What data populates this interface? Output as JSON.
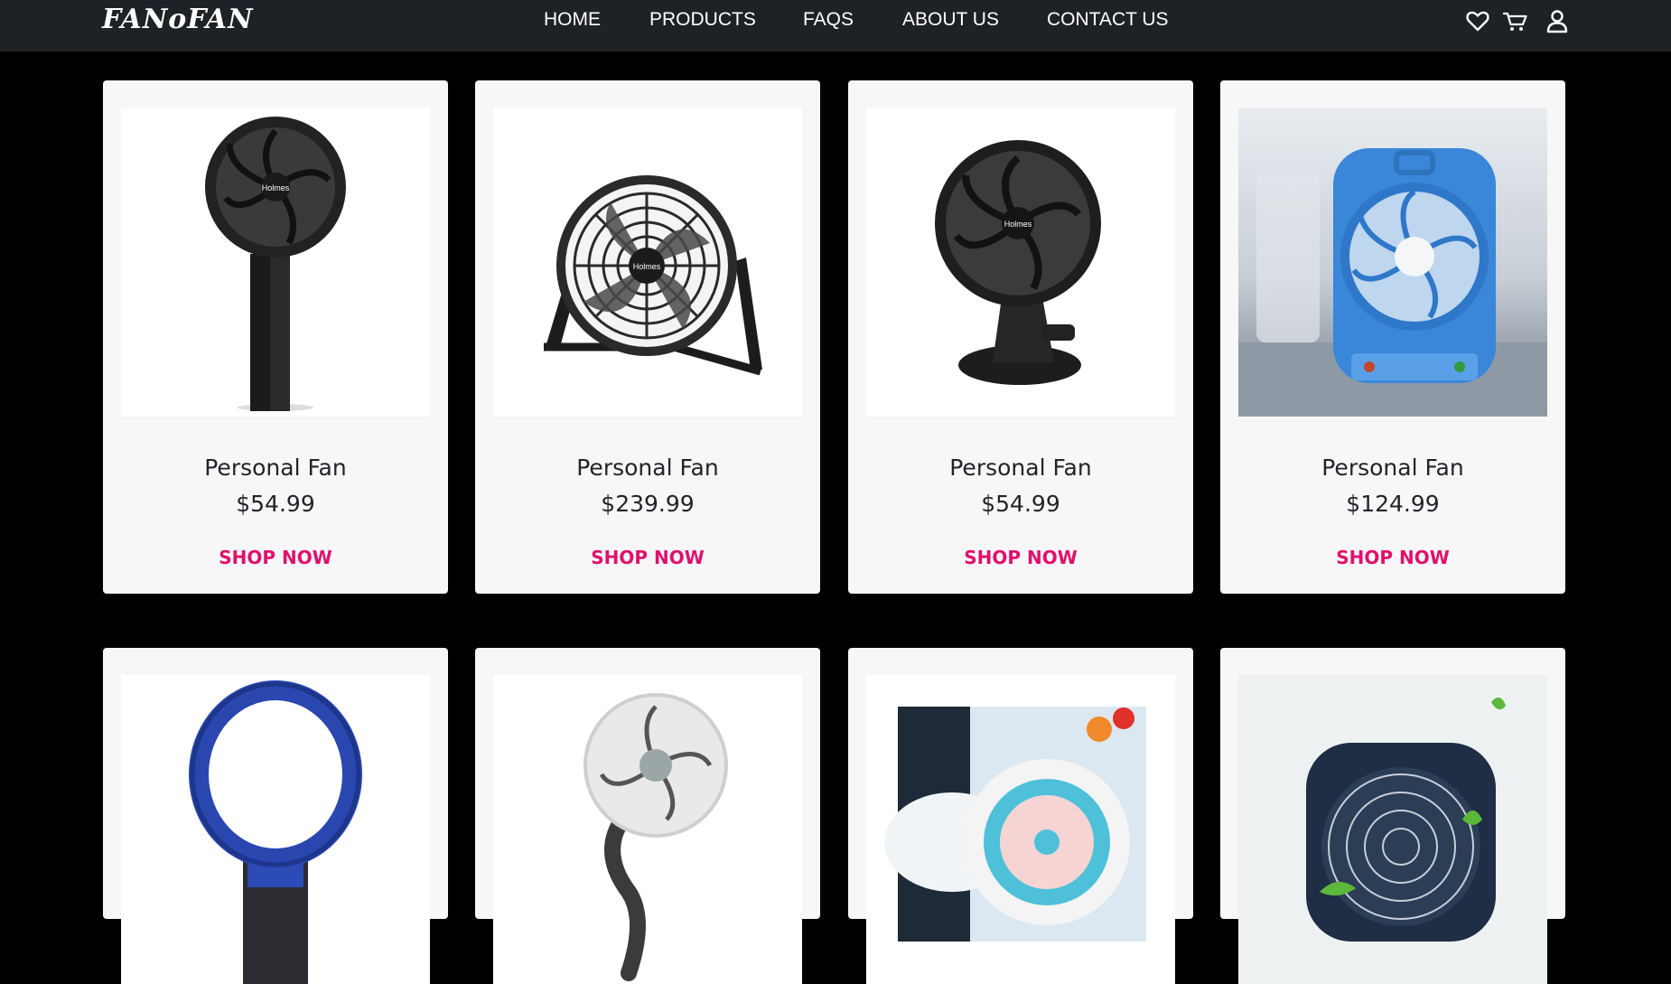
{
  "brand": {
    "logo_text": "FANoFAN"
  },
  "nav": {
    "links": [
      "HOME",
      "PRODUCTS",
      "FAQS",
      "ABOUT US",
      "CONTACT US"
    ],
    "icons": [
      "heart-icon",
      "cart-icon",
      "user-icon"
    ]
  },
  "colors": {
    "navbar_bg": "#1e2126",
    "page_bg": "#000000",
    "card_bg": "#f7f7f8",
    "accent": "#e0106d"
  },
  "products": [
    {
      "name": "Personal Fan",
      "price": "$54.99",
      "cta": "SHOP NOW",
      "image": "black-handheld-fan"
    },
    {
      "name": "Personal Fan",
      "price": "$239.99",
      "cta": "SHOP NOW",
      "image": "black-desk-fan"
    },
    {
      "name": "Personal Fan",
      "price": "$54.99",
      "cta": "SHOP NOW",
      "image": "black-clip-fan"
    },
    {
      "name": "Personal Fan",
      "price": "$124.99",
      "cta": "SHOP NOW",
      "image": "blue-portable-fan"
    },
    {
      "image": "blue-bladeless-fan"
    },
    {
      "image": "white-gooseneck-fan"
    },
    {
      "image": "turquoise-mist-fan"
    },
    {
      "image": "navy-desk-fan"
    }
  ]
}
